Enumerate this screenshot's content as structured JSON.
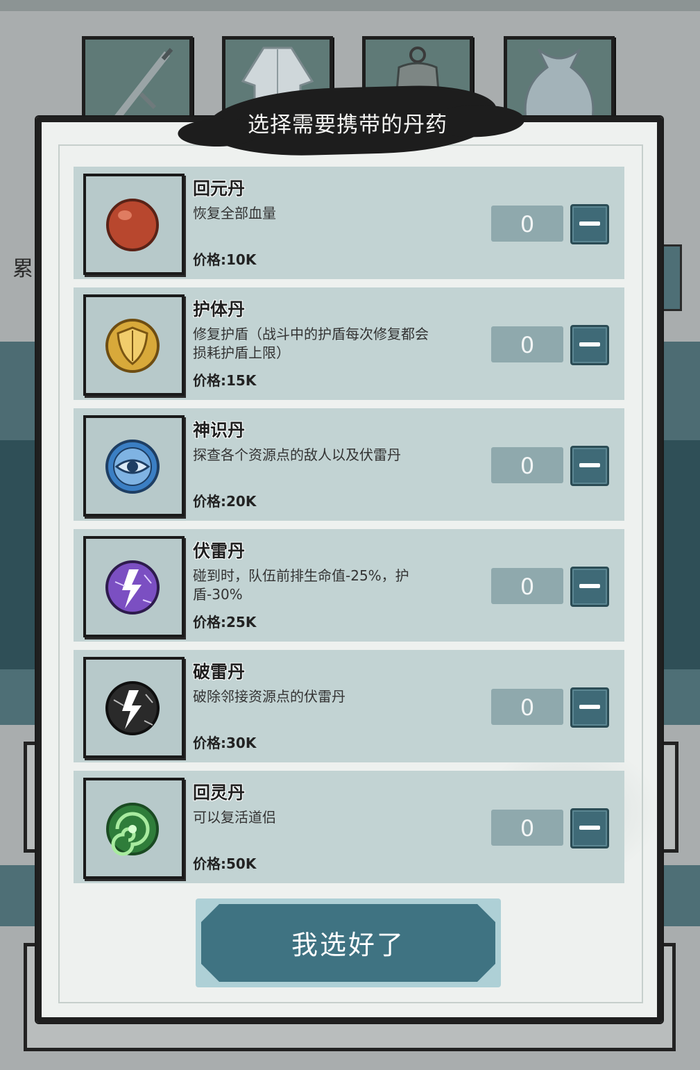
{
  "background": {
    "left_text": "累",
    "slots": [
      {
        "name": "sword-slot",
        "icon": "sword-icon"
      },
      {
        "name": "robe-slot",
        "icon": "robe-icon"
      },
      {
        "name": "bell-slot",
        "icon": "bell-icon"
      },
      {
        "name": "bag-slot",
        "icon": "bag-icon"
      }
    ]
  },
  "dialog": {
    "title": "选择需要携带的丹药",
    "items": [
      {
        "name": "回元丹",
        "desc": "恢复全部血量",
        "price": "价格:10K",
        "qty": "0",
        "icon": "red-pill-icon",
        "color": "#b8472e"
      },
      {
        "name": "护体丹",
        "desc": "修复护盾（战斗中的护盾每次修复都会损耗护盾上限）",
        "price": "价格:15K",
        "qty": "0",
        "icon": "shield-pill-icon",
        "color": "#d8a93a"
      },
      {
        "name": "神识丹",
        "desc": "探查各个资源点的敌人以及伏雷丹",
        "price": "价格:20K",
        "qty": "0",
        "icon": "eye-pill-icon",
        "color": "#3b7fc4"
      },
      {
        "name": "伏雷丹",
        "desc": "碰到时，队伍前排生命值-25%，护盾-30%",
        "price": "价格:25K",
        "qty": "0",
        "icon": "purple-lightning-icon",
        "color": "#7b4fc2"
      },
      {
        "name": "破雷丹",
        "desc": "破除邻接资源点的伏雷丹",
        "price": "价格:30K",
        "qty": "0",
        "icon": "black-lightning-icon",
        "color": "#2a2a2a"
      },
      {
        "name": "回灵丹",
        "desc": "可以复活道侣",
        "price": "价格:50K",
        "qty": "0",
        "icon": "green-swirl-icon",
        "color": "#4fae5a"
      }
    ],
    "minus_symbol": "−",
    "confirm_label": "我选好了"
  }
}
